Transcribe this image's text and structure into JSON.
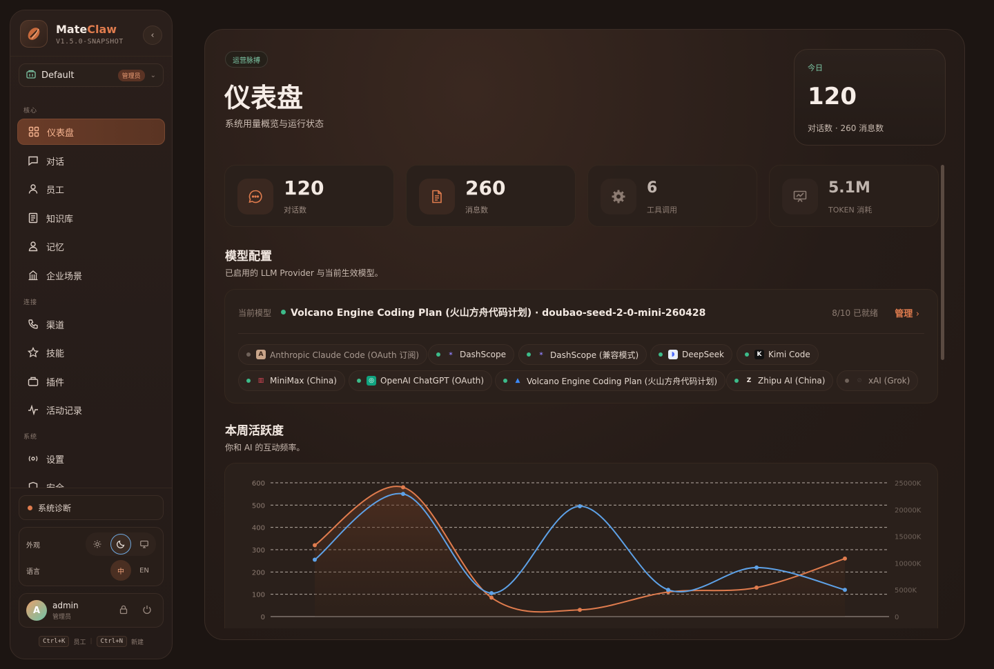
{
  "brand": {
    "name_a": "Mate",
    "name_b": "Claw",
    "version": "V1.5.0-SNAPSHOT"
  },
  "workspace": {
    "name": "Default",
    "role_badge": "管理员"
  },
  "nav": {
    "section_core": "核心",
    "section_connect": "连接",
    "section_system": "系统",
    "core": [
      {
        "label": "仪表盘",
        "icon": "grid-icon",
        "active": true
      },
      {
        "label": "对话",
        "icon": "chat-icon"
      },
      {
        "label": "员工",
        "icon": "person-icon"
      },
      {
        "label": "知识库",
        "icon": "book-icon"
      },
      {
        "label": "记忆",
        "icon": "memory-icon"
      },
      {
        "label": "企业场景",
        "icon": "building-icon"
      }
    ],
    "connect": [
      {
        "label": "渠道",
        "icon": "phone-icon"
      },
      {
        "label": "技能",
        "icon": "star-icon"
      },
      {
        "label": "插件",
        "icon": "plugin-icon"
      },
      {
        "label": "活动记录",
        "icon": "activity-icon"
      }
    ],
    "system": [
      {
        "label": "设置",
        "icon": "settings-icon"
      },
      {
        "label": "安全",
        "icon": "shield-icon"
      }
    ]
  },
  "diagnostics": {
    "label": "系统诊断"
  },
  "prefs": {
    "appearance_label": "外观",
    "language_label": "语言",
    "lang_zh": "中",
    "lang_en": "EN"
  },
  "user": {
    "name": "admin",
    "role": "管理员",
    "initial": "A"
  },
  "shortcuts": [
    {
      "key": "Ctrl+K",
      "label": "员工"
    },
    {
      "key": "Ctrl+N",
      "label": "新建"
    }
  ],
  "header": {
    "pill": "运营脉搏",
    "title": "仪表盘",
    "subtitle": "系统用量概览与运行状态"
  },
  "today": {
    "label": "今日",
    "value": "120",
    "detail": "对话数 · 260 消息数"
  },
  "stats": [
    {
      "value": "120",
      "label": "对话数",
      "icon": "chat-bubble-icon",
      "color": "#e07c4e"
    },
    {
      "value": "260",
      "label": "消息数",
      "icon": "document-icon",
      "color": "#e07c4e"
    },
    {
      "value": "6",
      "label": "工具调用",
      "icon": "gear-icon",
      "color": "#9b8a80"
    },
    {
      "value": "5.1M",
      "label": "TOKEN 消耗",
      "icon": "presentation-icon",
      "color": "#9b8a80"
    }
  ],
  "models": {
    "title": "模型配置",
    "subtitle": "已启用的 LLM Provider 与当前生效模型。",
    "current_label": "当前模型",
    "current_model": "Volcano Engine Coding Plan (火山方舟代码计划) · doubao-seed-2-0-mini-260428",
    "ready": "8/10 已就绪",
    "manage": "管理",
    "providers": [
      {
        "name": "Anthropic Claude Code (OAuth 订阅)",
        "enabled": false,
        "logo": "anthropic-logo-icon"
      },
      {
        "name": "DashScope",
        "enabled": true,
        "logo": "dashscope-logo-icon"
      },
      {
        "name": "DashScope (兼容模式)",
        "enabled": true,
        "logo": "dashscope-logo-icon"
      },
      {
        "name": "DeepSeek",
        "enabled": true,
        "logo": "deepseek-logo-icon"
      },
      {
        "name": "Kimi Code",
        "enabled": true,
        "logo": "kimi-logo-icon"
      },
      {
        "name": "MiniMax (China)",
        "enabled": true,
        "logo": "minimax-logo-icon"
      },
      {
        "name": "OpenAI ChatGPT (OAuth)",
        "enabled": true,
        "logo": "openai-logo-icon"
      },
      {
        "name": "Volcano Engine Coding Plan (火山方舟代码计划)",
        "enabled": true,
        "logo": "volcano-logo-icon"
      },
      {
        "name": "Zhipu AI (China)",
        "enabled": true,
        "logo": "zhipu-logo-icon"
      },
      {
        "name": "xAI (Grok)",
        "enabled": false,
        "logo": "xai-logo-icon"
      }
    ]
  },
  "activity": {
    "title": "本周活跃度",
    "subtitle": "你和 AI 的互动频率。"
  },
  "chart_data": {
    "type": "line",
    "title": "",
    "xlabel": "",
    "ylabel": "",
    "ylim": [
      0,
      600
    ],
    "y2lim": [
      0,
      25000
    ],
    "y_ticks": [
      "600",
      "500",
      "400",
      "300",
      "200",
      "100",
      "0"
    ],
    "y2_ticks": [
      "25000K",
      "20000K",
      "15000K",
      "10000K",
      "5000K",
      "0"
    ],
    "grid": true,
    "series": [
      {
        "axis": "left",
        "color": "#e07c4e",
        "values": [
          320,
          580,
          85,
          30,
          110,
          130,
          260
        ]
      },
      {
        "axis": "left",
        "color": "#5ea2e8",
        "values": [
          255,
          550,
          105,
          495,
          120,
          220,
          120
        ]
      }
    ]
  }
}
